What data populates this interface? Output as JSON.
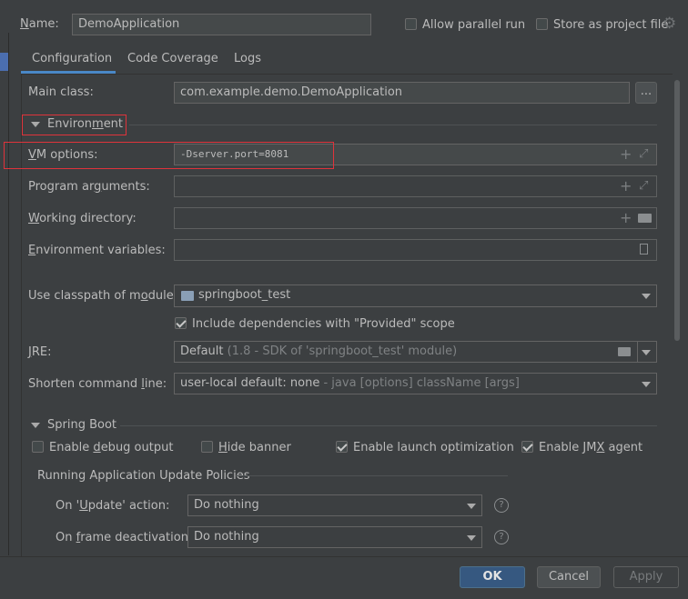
{
  "header": {
    "name_label": "Name:",
    "name_value": "DemoApplication",
    "allow_parallel_label": "Allow parallel run",
    "store_project_label": "Store as project file"
  },
  "tabs": [
    {
      "label": "Configuration",
      "active": true
    },
    {
      "label": "Code Coverage",
      "active": false
    },
    {
      "label": "Logs",
      "active": false
    }
  ],
  "form": {
    "main_class_label": "Main class:",
    "main_class_value": "com.example.demo.DemoApplication",
    "browse_label": "...",
    "environment_label": "Environment",
    "vm_options_label": "VM options:",
    "vm_options_value": "-Dserver.port=8081",
    "program_args_label": "Program arguments:",
    "working_dir_label": "Working directory:",
    "env_vars_label": "Environment variables:",
    "classpath_label": "Use classpath of module:",
    "classpath_value": "springboot_test",
    "include_deps_label": "Include dependencies with \"Provided\" scope",
    "jre_label": "JRE:",
    "jre_value": "Default",
    "jre_detail": "(1.8 - SDK of 'springboot_test' module)",
    "shorten_label": "Shorten command line:",
    "shorten_value": "user-local default: none",
    "shorten_detail": "- java [options] className [args]"
  },
  "spring_boot": {
    "section_label": "Spring Boot",
    "debug_label": "Enable debug output",
    "hide_banner_label": "Hide banner",
    "launch_opt_label": "Enable launch optimization",
    "jmx_label": "Enable JMX agent",
    "policies_label": "Running Application Update Policies",
    "update_action_label": "On 'Update' action:",
    "update_action_value": "Do nothing",
    "frame_deactivation_label": "On frame deactivation:",
    "frame_deactivation_value": "Do nothing"
  },
  "footer": {
    "ok_label": "OK",
    "cancel_label": "Cancel",
    "apply_label": "Apply"
  },
  "colors": {
    "accent_blue": "#365880",
    "highlight_red": "#e0333b",
    "tab_underline": "#4a88c7"
  }
}
